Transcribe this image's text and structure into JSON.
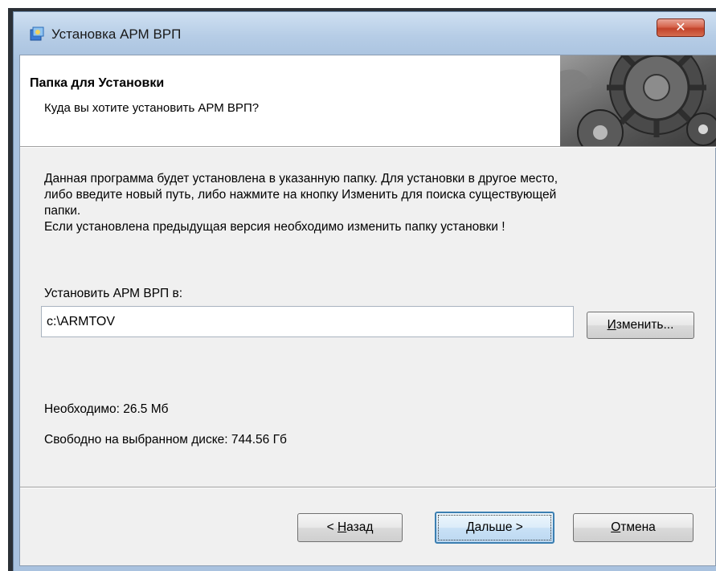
{
  "window": {
    "title": "Установка АРМ ВРП",
    "close_label": "✕"
  },
  "header": {
    "title": "Папка для Установки",
    "subtitle": "Куда вы хотите установить АРМ ВРП?"
  },
  "body": {
    "lines": [
      "Данная программа будет установлена в указанную папку. Для установки в другое место,",
      "либо введите новый путь, либо нажмите на кнопку Изменить для поиска существующей",
      "папки.",
      "Если установлена предыдущая версия необходимо изменить папку установки !"
    ]
  },
  "install_path": {
    "label": "Установить АРМ ВРП в:",
    "value": "c:\\ARMTOV",
    "change_button": {
      "underlined": "И",
      "rest": "зменить..."
    }
  },
  "disk_info": {
    "required": "Необходимо: 26.5 Мб",
    "free": "Свободно на выбранном диске: 744.56 Гб"
  },
  "buttons": {
    "back": {
      "prefix": "< ",
      "underlined": "Н",
      "rest": "азад"
    },
    "next": {
      "underlined": "Д",
      "rest": "альше >"
    },
    "cancel": {
      "underlined": "О",
      "rest": "тмена"
    }
  },
  "icons": {
    "window_icon": "installer-icon",
    "banner": "gears-banner-image"
  }
}
